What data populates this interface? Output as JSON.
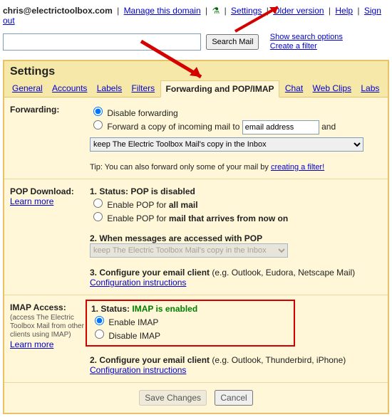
{
  "topbar": {
    "email": "chris@electrictoolbox.com",
    "manage": "Manage this domain",
    "settings": "Settings",
    "older": "Older version",
    "help": "Help",
    "signout": "Sign out"
  },
  "search": {
    "button": "Search Mail",
    "options": "Show search options",
    "createfilter": "Create a filter"
  },
  "title": "Settings",
  "tabs": {
    "general": "General",
    "accounts": "Accounts",
    "labels": "Labels",
    "filters": "Filters",
    "fwdpop": "Forwarding and POP/IMAP",
    "chat": "Chat",
    "webclips": "Web Clips",
    "labs": "Labs"
  },
  "forwarding": {
    "label": "Forwarding:",
    "disable": "Disable forwarding",
    "forward": "Forward a copy of incoming mail to",
    "emailplaceholder": "email address",
    "and": "and",
    "keep": "keep The Electric Toolbox Mail's copy in the Inbox",
    "tip_pre": "Tip: You can also forward only some of your mail by ",
    "tip_link": "creating a filter!"
  },
  "pop": {
    "label": "POP Download:",
    "learn": "Learn more",
    "status_label": "1. Status:",
    "status_value": "POP is disabled",
    "enable_all_pre": "Enable POP for ",
    "enable_all_bold": "all mail",
    "enable_now_pre": "Enable POP for ",
    "enable_now_bold": "mail that arrives from now on",
    "accessed": "2. When messages are accessed with POP",
    "keep": "keep The Electric Toolbox Mail's copy in the Inbox",
    "configure_bold": "3. Configure your email client",
    "configure_rest": " (e.g. Outlook, Eudora, Netscape Mail)",
    "conf_link": "Configuration instructions"
  },
  "imap": {
    "label": "IMAP Access:",
    "sub": "(access The Electric Toolbox Mail from other clients using IMAP)",
    "learn": "Learn more",
    "status_label": "1. Status:",
    "status_value": "IMAP is enabled",
    "enable": "Enable IMAP",
    "disable": "Disable IMAP",
    "configure_bold": "2. Configure your email client",
    "configure_rest": " (e.g. Outlook, Thunderbird, iPhone)",
    "conf_link": "Configuration instructions"
  },
  "buttons": {
    "save": "Save Changes",
    "cancel": "Cancel"
  }
}
